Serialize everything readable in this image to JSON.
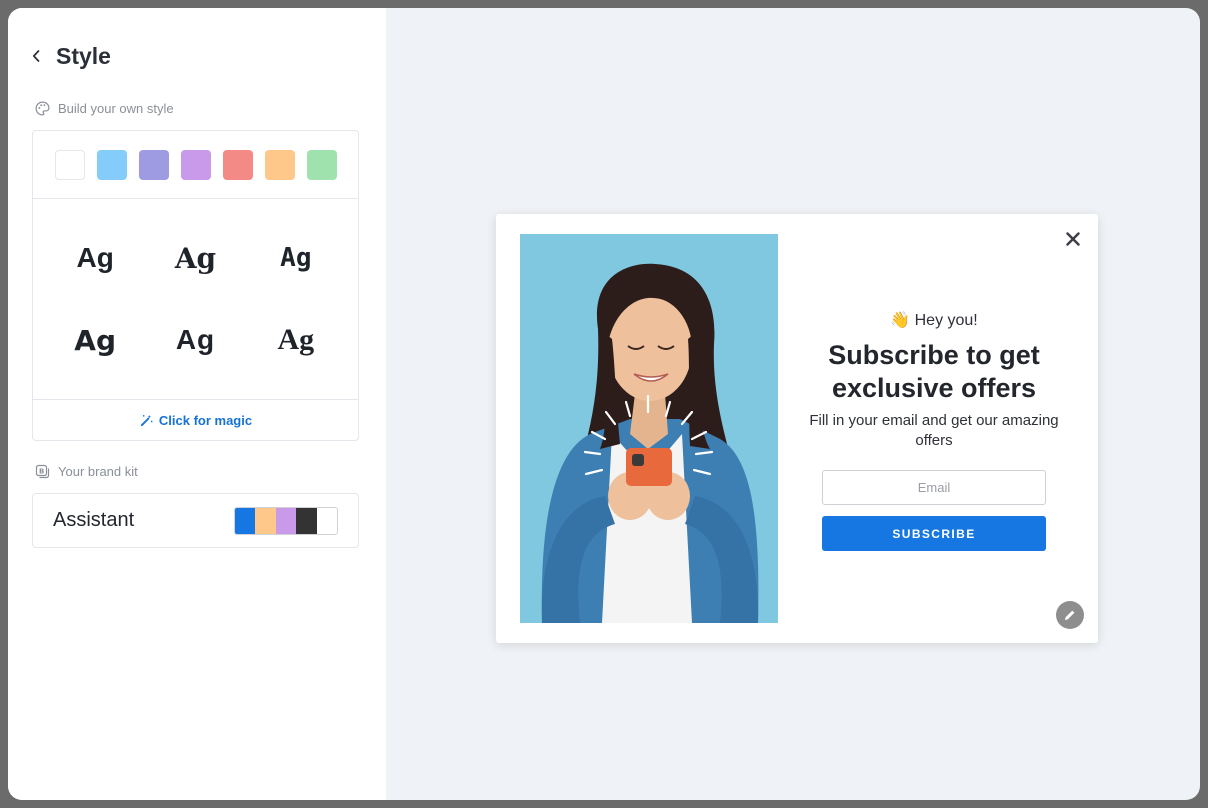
{
  "sidebar": {
    "title": "Style",
    "build_section_label": "Build your own style",
    "swatches": [
      "#ffffff",
      "#84cdfb",
      "#9e9be3",
      "#c999ea",
      "#f48a85",
      "#fdc88a",
      "#9fe2ae"
    ],
    "font_samples": [
      "Ag",
      "Ag",
      "Ag",
      "Ag",
      "Ag",
      "Ag"
    ],
    "magic_label": "Click for magic",
    "brand_section_label": "Your brand kit",
    "brand_kit": {
      "name": "Assistant",
      "palette": [
        "#1677e3",
        "#fdc88a",
        "#c999ea",
        "#333333",
        "#ffffff"
      ]
    }
  },
  "popup": {
    "greeting_emoji": "👋",
    "greeting": "Hey you!",
    "headline": "Subscribe to get exclusive offers",
    "subtext": "Fill in your email and get our amazing offers",
    "email_placeholder": "Email",
    "subscribe_label": "SUBSCRIBE"
  },
  "colors": {
    "accent": "#1677e3",
    "hero_background": "#7fc8e0"
  }
}
